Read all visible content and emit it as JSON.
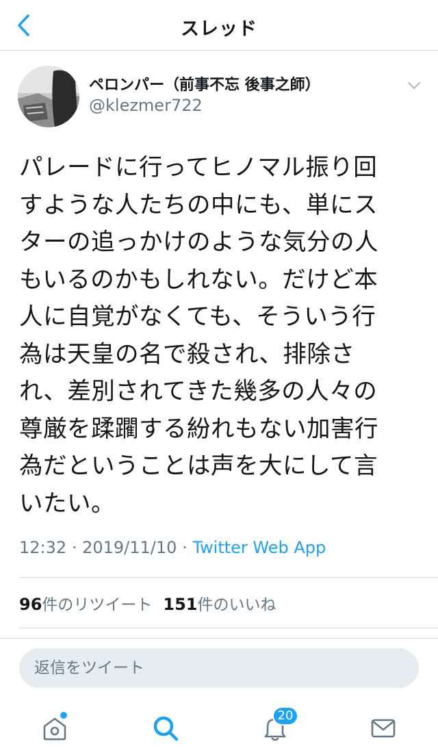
{
  "header": {
    "title": "スレッド",
    "back_icon": "chevron-left-icon"
  },
  "tweet": {
    "author_name": "ペロンパー（前事不忘 後事之師）",
    "author_handle": "@klezmer722",
    "text_lines": [
      "パレードに行ってヒノマル振り回",
      "すような人たちの中にも、単にス",
      "ターの追っかけのような気分の人",
      "もいるのかもしれない。だけど本",
      "人に自覚がなくても、そういう行",
      "為は天皇の名で殺され、排除さ",
      "れ、差別されてきた幾多の人々の",
      "尊厳を蹂躙する紛れもない加害行",
      "為だということは声を大にして言",
      "いたい。"
    ],
    "time": "12:32",
    "separator": "·",
    "date": "2019/11/10",
    "source": "Twitter Web App"
  },
  "stats": {
    "retweet_count": "96",
    "retweet_label": "件のリツイート",
    "like_count": "151",
    "like_label": "件のいいね"
  },
  "reply": {
    "placeholder": "返信をツイート"
  },
  "tabbar": {
    "notification_badge": "20",
    "accent_color": "#1da1f2",
    "icons": [
      "home-icon",
      "search-icon",
      "notifications-icon",
      "messages-icon"
    ]
  }
}
